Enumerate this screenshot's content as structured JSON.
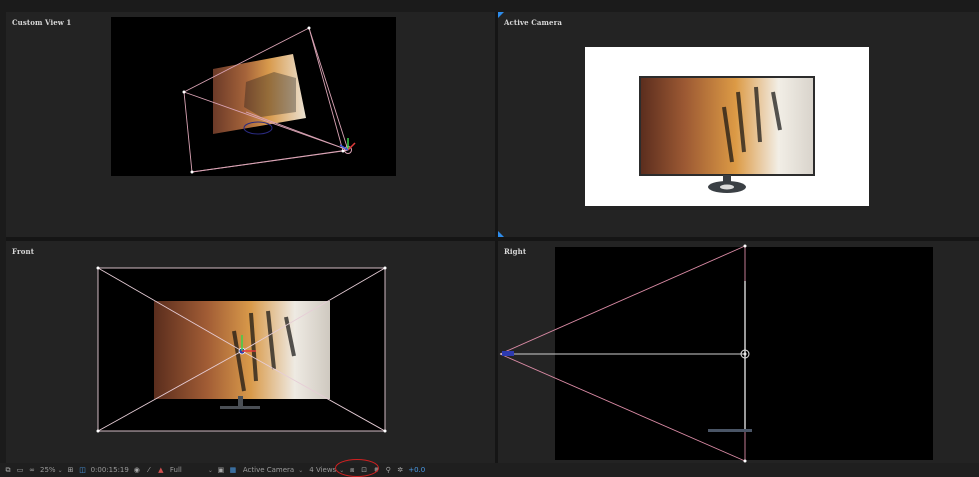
{
  "viewports": {
    "top_left": {
      "label": "Custom View 1"
    },
    "top_right": {
      "label": "Active Camera"
    },
    "bottom_left": {
      "label": "Front"
    },
    "bottom_right": {
      "label": "Right"
    }
  },
  "statusbar": {
    "zoom": "25%",
    "timecode": "0:00:15:19",
    "resolution": "Full",
    "camera": "Active Camera",
    "views": "4 Views",
    "exposure": "+0.0"
  },
  "colors": {
    "accent": "#2d8ceb",
    "wire": "#d9a3b4",
    "annotation": "#d02020"
  },
  "icons": [
    "snapshot-icon",
    "region-icon",
    "channel-icon",
    "grid-icon",
    "mask-icon",
    "camera-icon",
    "color-icon",
    "transparency-icon",
    "renderer-icon",
    "reset-exposure-icon",
    "3d-icon"
  ]
}
